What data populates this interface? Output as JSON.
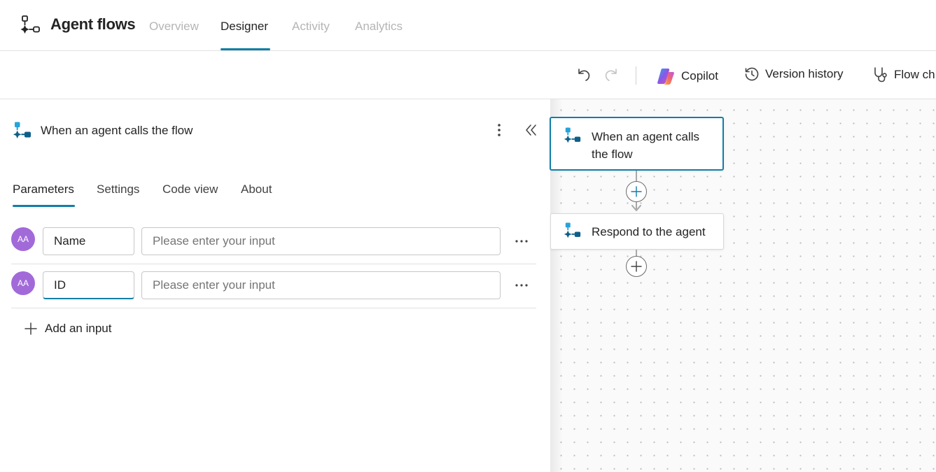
{
  "app": {
    "title": "Agent flows",
    "accent_color": "#117ea7"
  },
  "nav": {
    "tabs": [
      {
        "label": "Overview",
        "active": false
      },
      {
        "label": "Designer",
        "active": true
      },
      {
        "label": "Activity",
        "active": false
      },
      {
        "label": "Analytics",
        "active": false
      }
    ]
  },
  "toolbar": {
    "undo_icon": "undo-icon",
    "redo_icon": "redo-icon",
    "copilot_label": "Copilot",
    "version_history_label": "Version history",
    "flow_checker_label": "Flow ch"
  },
  "panel": {
    "title": "When an agent calls the flow",
    "tabs": [
      {
        "label": "Parameters",
        "active": true
      },
      {
        "label": "Settings",
        "active": false
      },
      {
        "label": "Code view",
        "active": false
      },
      {
        "label": "About",
        "active": false
      }
    ],
    "params": [
      {
        "avatar": "AA",
        "name": "Name",
        "placeholder": "Please enter your input",
        "focused": false
      },
      {
        "avatar": "AA",
        "name": "ID",
        "placeholder": "Please enter your input",
        "focused": true
      }
    ],
    "add_input_label": "Add an input"
  },
  "canvas": {
    "nodes": [
      {
        "label_line1": "When an agent calls",
        "label_line2": "the flow",
        "selected": true
      },
      {
        "label": "Respond to the agent",
        "selected": false
      }
    ]
  }
}
